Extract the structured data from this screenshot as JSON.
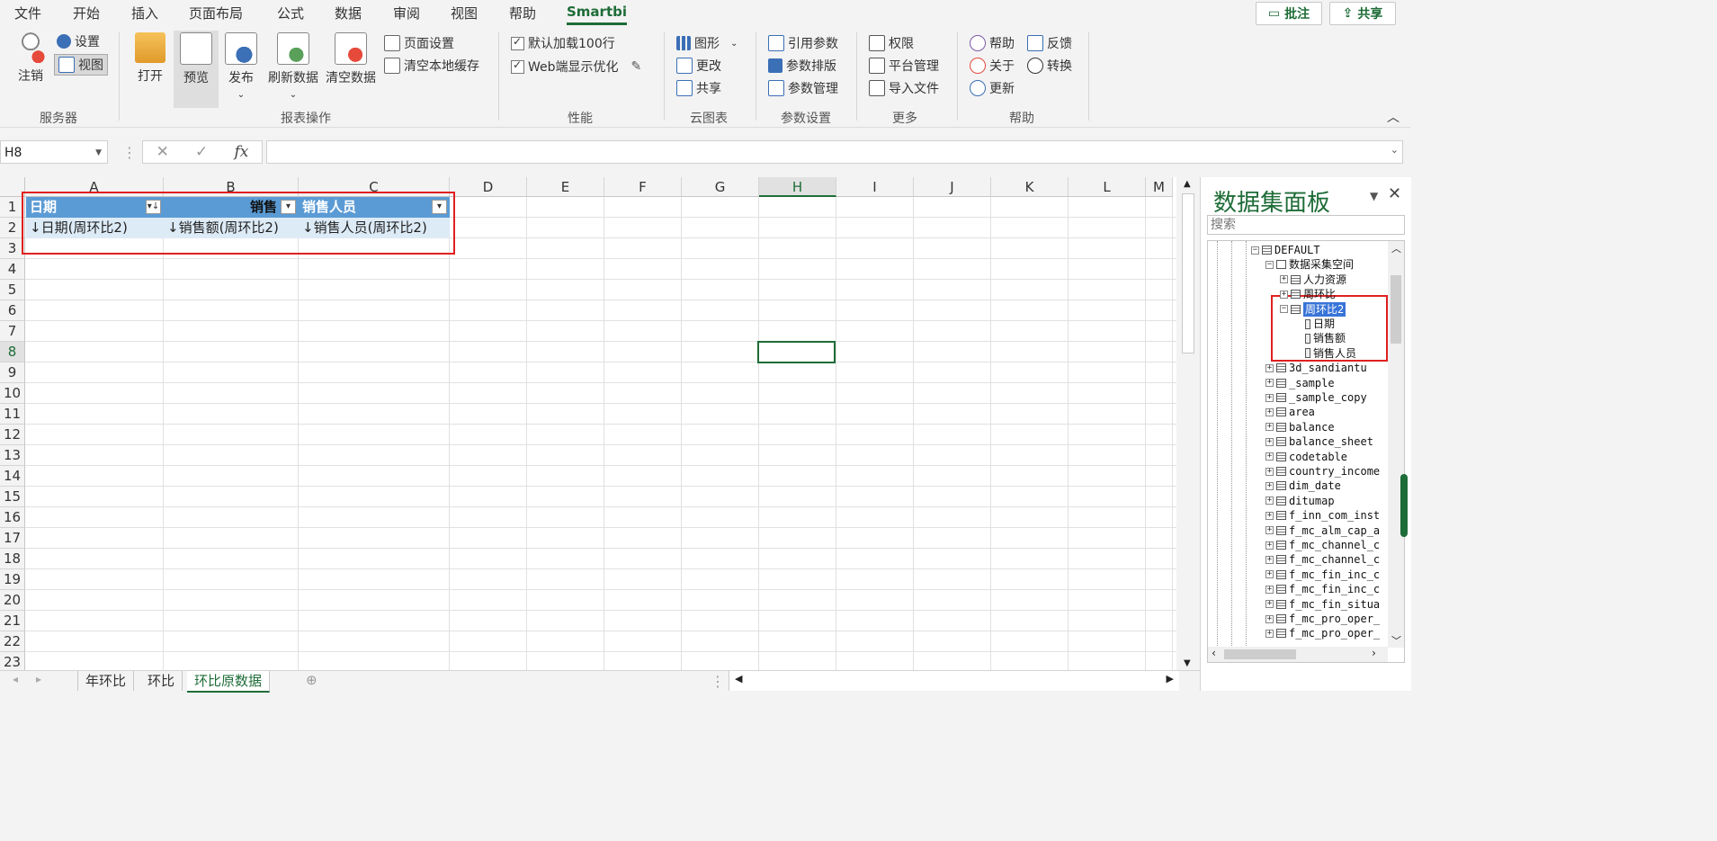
{
  "menu_tabs": [
    "文件",
    "开始",
    "插入",
    "页面布局",
    "公式",
    "数据",
    "审阅",
    "视图",
    "帮助",
    "Smartbi"
  ],
  "top_buttons": {
    "comment": "批注",
    "share": "共享"
  },
  "ribbon": {
    "server": {
      "logout": "注销",
      "settings": "设置",
      "view": "视图",
      "group": "服务器"
    },
    "report": {
      "open": "打开",
      "preview": "预览",
      "publish": "发布",
      "refresh": "刷新数据",
      "clear": "清空数据",
      "page_setup": "页面设置",
      "clear_cache": "清空本地缓存",
      "group": "报表操作"
    },
    "perf": {
      "default_load": "默认加载100行",
      "web_opt": "Web端显示优化",
      "group": "性能"
    },
    "cloud": {
      "graph": "图形",
      "change": "更改",
      "share": "共享",
      "group": "云图表"
    },
    "params": {
      "ref": "引用参数",
      "layout": "参数排版",
      "manage": "参数管理",
      "group": "参数设置"
    },
    "more": {
      "perm": "权限",
      "platform": "平台管理",
      "import": "导入文件",
      "group": "更多"
    },
    "help": {
      "help": "帮助",
      "feedback": "反馈",
      "about": "关于",
      "convert": "转换",
      "update": "更新",
      "group": "帮助"
    }
  },
  "formula": {
    "cell_ref": "H8",
    "fx": "fx",
    "content": ""
  },
  "columns": [
    "A",
    "B",
    "C",
    "D",
    "E",
    "F",
    "G",
    "H",
    "I",
    "J",
    "K",
    "L",
    "M"
  ],
  "rows": [
    "1",
    "2",
    "3",
    "4",
    "5",
    "6",
    "7",
    "8",
    "9",
    "10",
    "11",
    "12",
    "13",
    "14",
    "15",
    "16",
    "17",
    "18",
    "19",
    "20",
    "21",
    "22",
    "23"
  ],
  "table": {
    "headers": [
      "日期",
      "销售",
      "销售人员"
    ],
    "cells": [
      "↓日期(周环比2)",
      "↓销售额(周环比2)",
      "↓销售人员(周环比2)"
    ]
  },
  "sheets": [
    "年环比",
    "环比",
    "环比原数据"
  ],
  "panel": {
    "title": "数据集面板",
    "search_placeholder": "搜索",
    "tree": [
      {
        "label": "DEFAULT",
        "level": 0,
        "box": "−",
        "type": "db"
      },
      {
        "label": "数据采集空间",
        "level": 1,
        "box": "−",
        "type": "folder"
      },
      {
        "label": "人力资源",
        "level": 2,
        "box": "+",
        "type": "table"
      },
      {
        "label": "周环比",
        "level": 2,
        "box": "+",
        "type": "table"
      },
      {
        "label": "周环比2",
        "level": 2,
        "box": "−",
        "type": "table",
        "selected": true
      },
      {
        "label": "日期",
        "level": 3,
        "type": "field"
      },
      {
        "label": "销售额",
        "level": 3,
        "type": "field"
      },
      {
        "label": "销售人员",
        "level": 3,
        "type": "field"
      },
      {
        "label": "3d_sandiantu",
        "level": 1,
        "box": "+",
        "type": "table"
      },
      {
        "label": "_sample",
        "level": 1,
        "box": "+",
        "type": "table"
      },
      {
        "label": "_sample_copy",
        "level": 1,
        "box": "+",
        "type": "table"
      },
      {
        "label": "area",
        "level": 1,
        "box": "+",
        "type": "table"
      },
      {
        "label": "balance",
        "level": 1,
        "box": "+",
        "type": "table"
      },
      {
        "label": "balance_sheet",
        "level": 1,
        "box": "+",
        "type": "table"
      },
      {
        "label": "codetable",
        "level": 1,
        "box": "+",
        "type": "table"
      },
      {
        "label": "country_income",
        "level": 1,
        "box": "+",
        "type": "table"
      },
      {
        "label": "dim_date",
        "level": 1,
        "box": "+",
        "type": "table"
      },
      {
        "label": "ditumap",
        "level": 1,
        "box": "+",
        "type": "table"
      },
      {
        "label": "f_inn_com_inst",
        "level": 1,
        "box": "+",
        "type": "table"
      },
      {
        "label": "f_mc_alm_cap_a",
        "level": 1,
        "box": "+",
        "type": "table"
      },
      {
        "label": "f_mc_channel_c",
        "level": 1,
        "box": "+",
        "type": "table"
      },
      {
        "label": "f_mc_channel_c",
        "level": 1,
        "box": "+",
        "type": "table"
      },
      {
        "label": "f_mc_fin_inc_c",
        "level": 1,
        "box": "+",
        "type": "table"
      },
      {
        "label": "f_mc_fin_inc_c",
        "level": 1,
        "box": "+",
        "type": "table"
      },
      {
        "label": "f_mc_fin_situa",
        "level": 1,
        "box": "+",
        "type": "table"
      },
      {
        "label": "f_mc_pro_oper_",
        "level": 1,
        "box": "+",
        "type": "table"
      },
      {
        "label": "f_mc_pro_oper_",
        "level": 1,
        "box": "+",
        "type": "table"
      }
    ]
  },
  "colors": {
    "accent": "#1e6c37",
    "table_header": "#5b9bd5",
    "table_row": "#ddebf7",
    "highlight_box": "#e02020"
  }
}
